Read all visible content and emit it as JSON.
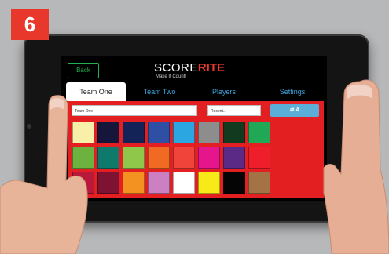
{
  "step_number": "6",
  "app": {
    "back_label": "Back",
    "logo_score": "SCORE",
    "logo_rite": "RITE",
    "logo_tagline": "Make It Count!",
    "tabs": [
      {
        "label": "Team One",
        "active": true
      },
      {
        "label": "Team Two",
        "active": false
      },
      {
        "label": "Players",
        "active": false
      },
      {
        "label": "Settings",
        "active": false
      }
    ],
    "team_name_value": "Team One",
    "recent_placeholder": "Recent...",
    "swap_label": "⇄ A",
    "panel_color": "#e41f22",
    "swatch_colors": [
      [
        "#f8f0a8",
        "#15163a",
        "#142357",
        "#2f4fa5",
        "#2ca6e0",
        "#8d8d8d",
        "#123a1f",
        "#21a857"
      ],
      [
        "#6db23f",
        "#0f7a6c",
        "#8fc74a",
        "#f06a24",
        "#f0433a",
        "#e5158c",
        "#5b2a86",
        "#ee1f2a"
      ],
      [
        "#b8193a",
        "#7d1233",
        "#f39220",
        "#cc80c2",
        "#ffffff",
        "#f7ea18",
        "#050505",
        "#a37345"
      ]
    ]
  },
  "colors": {
    "accent_red": "#e8372b",
    "tab_blue": "#3fa7e0",
    "back_green": "#22b14c"
  }
}
